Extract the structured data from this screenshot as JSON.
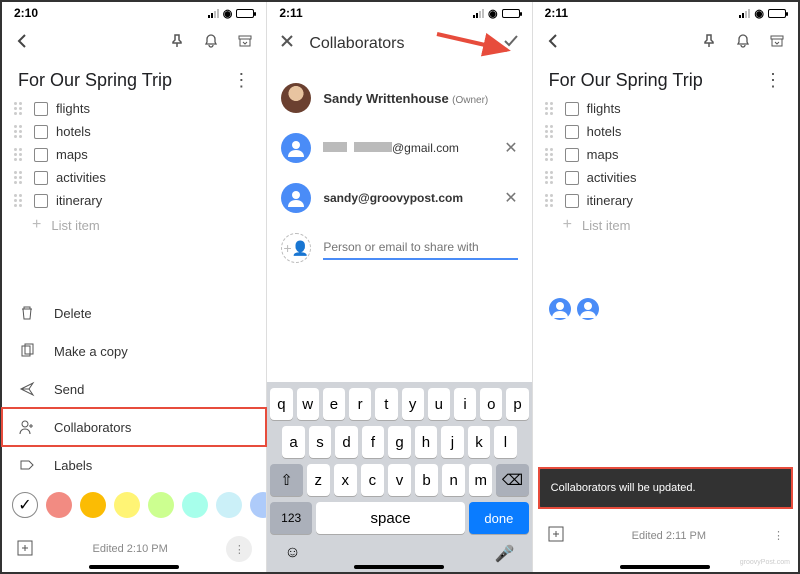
{
  "status": {
    "time1": "2:10",
    "time2": "2:11",
    "time3": "2:11"
  },
  "panel1": {
    "note_title": "For Our Spring Trip",
    "items": [
      "flights",
      "hotels",
      "maps",
      "activities",
      "itinerary"
    ],
    "add_item": "List item",
    "menu": {
      "delete": "Delete",
      "copy": "Make a copy",
      "send": "Send",
      "collaborators": "Collaborators",
      "labels": "Labels"
    },
    "colors": [
      "#ffffff",
      "#f28b82",
      "#fbbc04",
      "#fff475",
      "#ccff90",
      "#a7ffeb",
      "#cbf0f8",
      "#aecbfa"
    ],
    "footer_time": "Edited 2:10 PM"
  },
  "panel2": {
    "title": "Collaborators",
    "owner_name": "Sandy Writtenhouse",
    "owner_sub": "(Owner)",
    "person2_suffix": "@gmail.com",
    "person3": "sandy@groovypost.com",
    "input_placeholder": "Person or email to share with",
    "keys_r1": [
      "q",
      "w",
      "e",
      "r",
      "t",
      "y",
      "u",
      "i",
      "o",
      "p"
    ],
    "keys_r2": [
      "a",
      "s",
      "d",
      "f",
      "g",
      "h",
      "j",
      "k",
      "l"
    ],
    "keys_r3": [
      "z",
      "x",
      "c",
      "v",
      "b",
      "n",
      "m"
    ],
    "num_label": "123",
    "space_label": "space",
    "done_label": "done"
  },
  "panel3": {
    "note_title": "For Our Spring Trip",
    "items": [
      "flights",
      "hotels",
      "maps",
      "activities",
      "itinerary"
    ],
    "add_item": "List item",
    "toast": "Collaborators will be updated.",
    "footer_time": "Edited 2:11 PM"
  },
  "watermark": "groovyPost.com"
}
